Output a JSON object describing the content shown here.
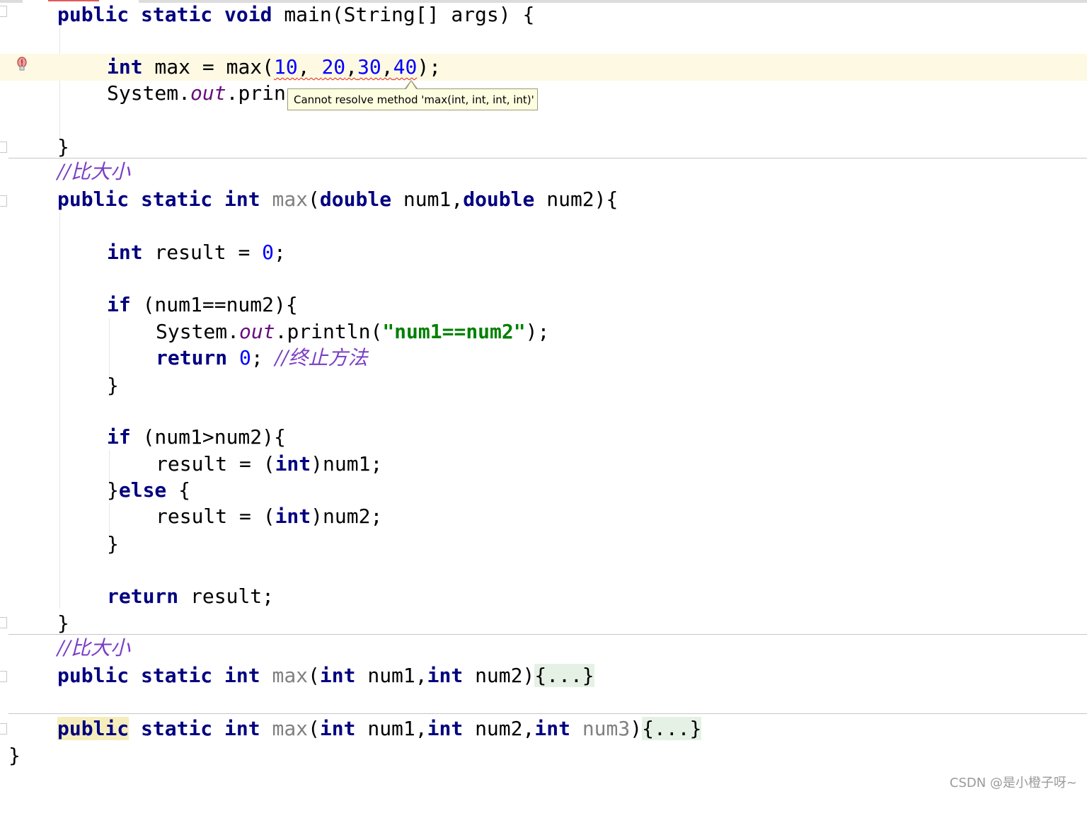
{
  "editor": {
    "lines": {
      "l1": {
        "a": "public",
        "b": "static",
        "c": "void",
        "d": " main(String[] args) {"
      },
      "l2": {
        "a": "int",
        "b": " max = max(",
        "n1": "10",
        "c": ", ",
        "n2": "20",
        "d": ",",
        "n3": "30",
        "e": ",",
        "n4": "40",
        "f": ");"
      },
      "l3": {
        "a": "System.",
        "b": "out",
        "c": ".prin"
      },
      "l4": {
        "a": "}"
      },
      "l5": {
        "a": "//比大小"
      },
      "l6": {
        "a": "public",
        "b": "static",
        "c": "int",
        "d": "max",
        "e": "(",
        "f": "double",
        "g": " num1,",
        "h": "double",
        "i": " num2){"
      },
      "l7": {
        "a": "int",
        "b": " result = ",
        "c": "0",
        "d": ";"
      },
      "l8": {
        "a": "if",
        "b": " (num1==num2){"
      },
      "l9": {
        "a": "System.",
        "b": "out",
        "c": ".println(",
        "d": "\"num1==num2\"",
        "e": ");"
      },
      "l10": {
        "a": "return",
        "b": "0",
        "c": "; ",
        "d": "//终止方法"
      },
      "l11": {
        "a": "}"
      },
      "l12": {
        "a": "if",
        "b": " (num1>num2){"
      },
      "l13": {
        "a": "result = (",
        "b": "int",
        "c": ")num1;"
      },
      "l14": {
        "a": "}",
        "b": "else",
        "c": " {"
      },
      "l15": {
        "a": "result = (",
        "b": "int",
        "c": ")num2;"
      },
      "l16": {
        "a": "}"
      },
      "l17": {
        "a": "return",
        "b": " result;"
      },
      "l18": {
        "a": "}"
      },
      "l19": {
        "a": "//比大小"
      },
      "l20": {
        "a": "public",
        "b": "static",
        "c": "int",
        "d": "max",
        "e": "(",
        "f": "int",
        "g": " num1,",
        "h": "int",
        "i": " num2)",
        "j": "{...}"
      },
      "l21": {
        "a": "public",
        "b": "static",
        "c": "int",
        "d": "max",
        "e": "(",
        "f": "int",
        "g": " num1,",
        "h": "int",
        "i": " num2,",
        "k": "int",
        "l": "num3",
        "m": ")",
        "j": "{...}"
      },
      "l22": {
        "a": "}"
      }
    }
  },
  "tooltip": {
    "text": "Cannot resolve method 'max(int, int, int, int)'"
  },
  "watermark": {
    "text": "CSDN @是小橙子呀~"
  },
  "icons": {
    "gutter": "lightbulb-error-icon"
  },
  "colors": {
    "keyword": "#000080",
    "number": "#0000ff",
    "string": "#008000",
    "comment": "#7a3ec5",
    "field": "#660e7a",
    "error": "#e02020",
    "caret_line": "#fdf9e3",
    "tooltip_bg": "#fdfde0"
  }
}
